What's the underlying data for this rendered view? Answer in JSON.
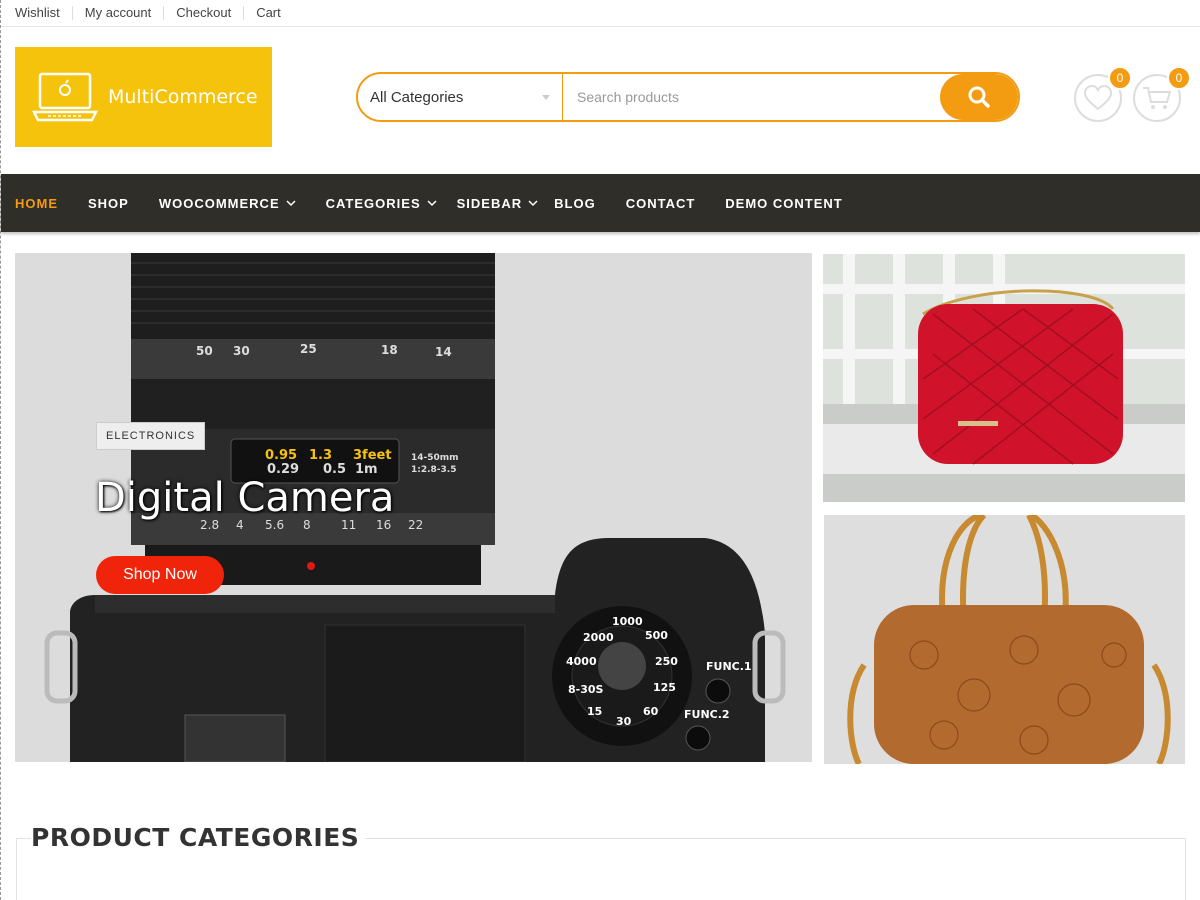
{
  "topbar": {
    "links": [
      "Wishlist",
      "My account",
      "Checkout",
      "Cart"
    ]
  },
  "logo": {
    "text": "MultiCommerce"
  },
  "search": {
    "category": "All Categories",
    "placeholder": "Search products"
  },
  "header_icons": {
    "wishlist_count": "0",
    "cart_count": "0"
  },
  "nav": {
    "items": [
      "HOME",
      "SHOP",
      "WOOCOMMERCE",
      "CATEGORIES",
      "SIDEBAR",
      "BLOG",
      "CONTACT",
      "DEMO CONTENT"
    ]
  },
  "hero": {
    "tag": "ELECTRONICS",
    "title": "Digital Camera",
    "button": "Shop Now",
    "lens_scale": [
      "50",
      "30",
      "25",
      "18",
      "14"
    ],
    "dof_scale": [
      "2.8",
      "4",
      "5.6",
      "8",
      "11",
      "16",
      "22"
    ],
    "distance_scale": [
      "0.95",
      "1.3",
      "3feet",
      "0.29",
      "0.5",
      "1m"
    ],
    "lens_info": [
      "14-50mm",
      "1:2.8-3.5"
    ],
    "dial_values": [
      "1000",
      "500",
      "250",
      "125",
      "60",
      "30",
      "15",
      "8-30S",
      "4000",
      "2000"
    ],
    "func_labels": [
      "FUNC.1",
      "FUNC.2"
    ]
  },
  "section": {
    "title": "PRODUCT CATEGORIES"
  },
  "colors": {
    "accent": "#f39c12",
    "logo_bg": "#f5c30c",
    "nav_bg": "#302e28",
    "cta": "#f0240a"
  }
}
